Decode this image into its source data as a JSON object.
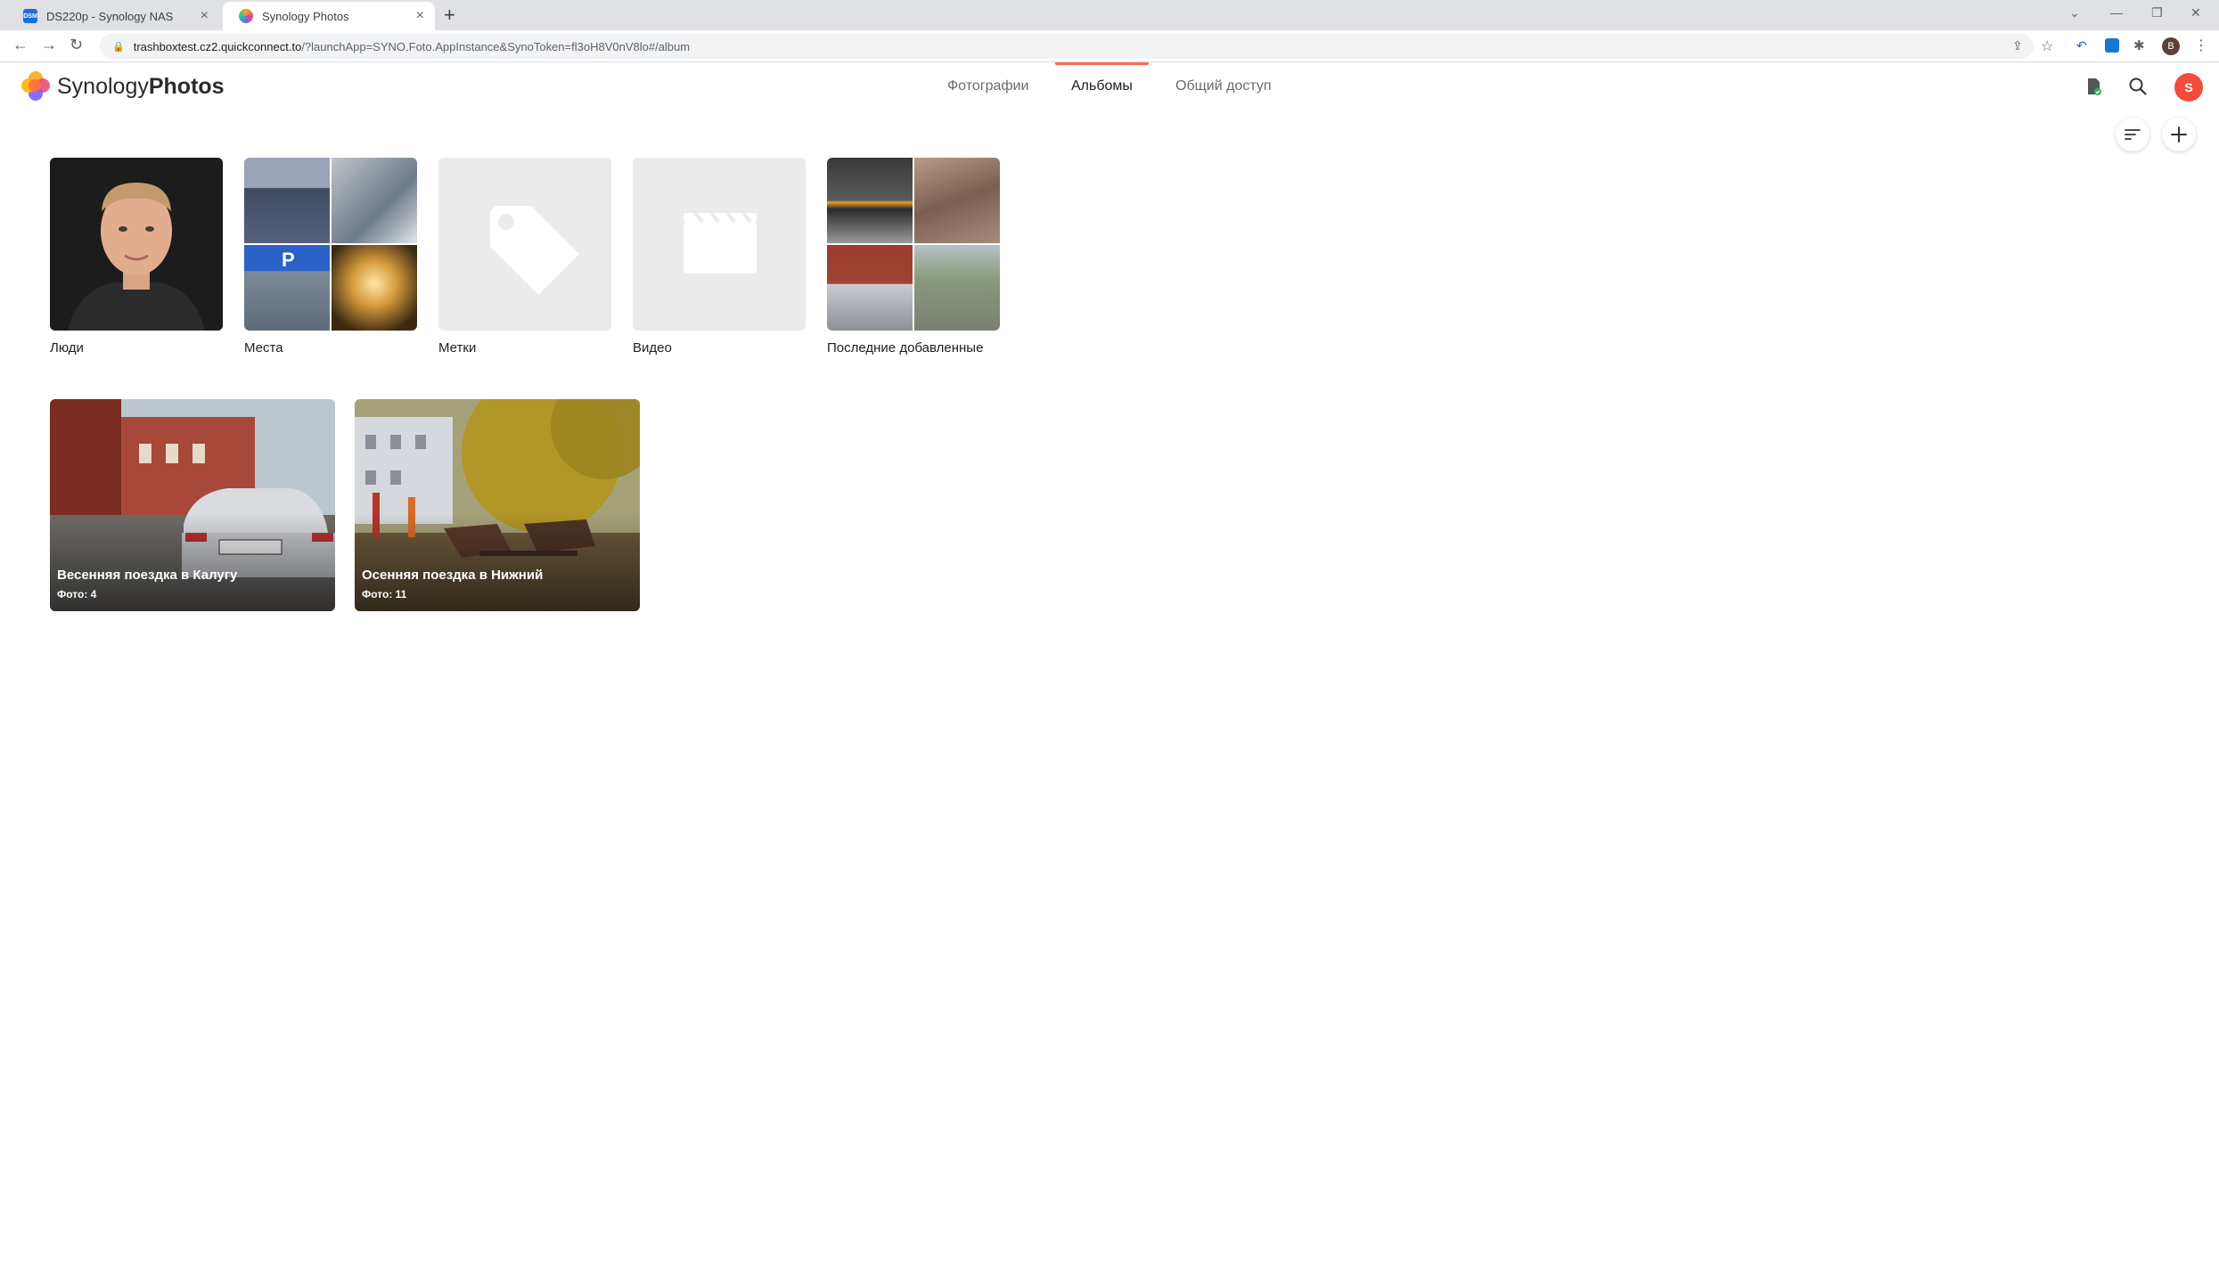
{
  "browser": {
    "tabs": [
      {
        "title": "DS220p - Synology NAS",
        "favicon": "DSM"
      },
      {
        "title": "Synology Photos"
      }
    ],
    "url_host": "trashboxtest.cz2.quickconnect.to",
    "url_path": "/?launchApp=SYNO.Foto.AppInstance&SynoToken=fl3oH8V0nV8lo#/album",
    "profile_initial": "B"
  },
  "app": {
    "brand_light": "Synology",
    "brand_bold": "Photos",
    "nav": [
      "Фотографии",
      "Альбомы",
      "Общий доступ"
    ],
    "active_nav": 1,
    "user_initial": "S",
    "accent": "#ff6b5a"
  },
  "albums_top": [
    {
      "label": "Люди"
    },
    {
      "label": "Места"
    },
    {
      "label": "Метки",
      "icon": "tag-icon"
    },
    {
      "label": "Видео",
      "icon": "clapperboard-icon"
    },
    {
      "label": "Последние добавленные"
    }
  ],
  "albums_user": [
    {
      "title": "Весенняя поездка в Калугу",
      "count": "Фото: 4"
    },
    {
      "title": "Осенняя поездка в Нижний",
      "count": "Фото: 11"
    }
  ]
}
